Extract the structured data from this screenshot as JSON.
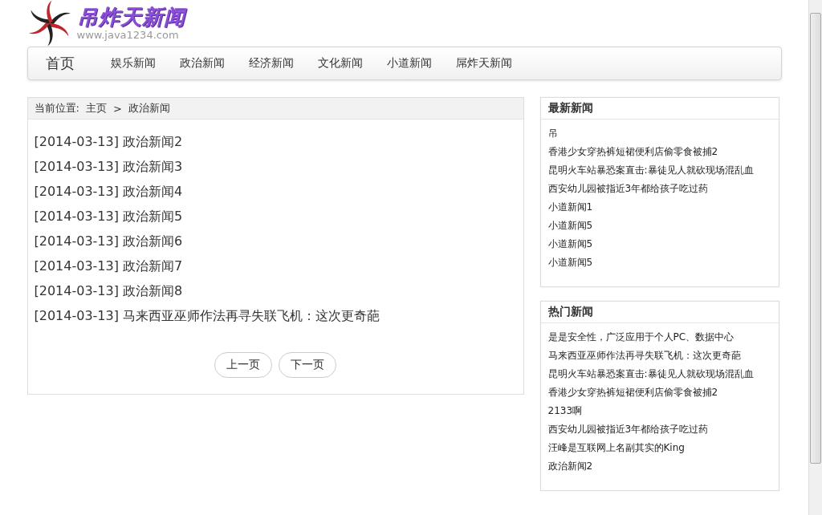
{
  "header": {
    "logo_text": "吊炸天新闻",
    "site_url": "www.java1234.com"
  },
  "nav": {
    "items": [
      {
        "label": "首页",
        "kind": "home"
      },
      {
        "label": "娱乐新闻",
        "kind": "link"
      },
      {
        "label": "政治新闻",
        "kind": "link"
      },
      {
        "label": "经济新闻",
        "kind": "link"
      },
      {
        "label": "文化新闻",
        "kind": "link"
      },
      {
        "label": "小道新闻",
        "kind": "link"
      },
      {
        "label": "屌炸天新闻",
        "kind": "link"
      }
    ]
  },
  "breadcrumb": {
    "label": "当前位置:",
    "items": [
      "主页",
      "政治新闻"
    ],
    "separator": ">"
  },
  "news_list": [
    {
      "date": "[2014-03-13]",
      "title": "政治新闻2"
    },
    {
      "date": "[2014-03-13]",
      "title": "政治新闻3"
    },
    {
      "date": "[2014-03-13]",
      "title": "政治新闻4"
    },
    {
      "date": "[2014-03-13]",
      "title": "政治新闻5"
    },
    {
      "date": "[2014-03-13]",
      "title": "政治新闻6"
    },
    {
      "date": "[2014-03-13]",
      "title": "政治新闻7"
    },
    {
      "date": "[2014-03-13]",
      "title": "政治新闻8"
    },
    {
      "date": "[2014-03-13]",
      "title": "马来西亚巫师作法再寻失联飞机：这次更奇葩"
    }
  ],
  "pagination": [
    "上一页",
    "下一页"
  ],
  "sidebar": [
    {
      "title": "最新新闻",
      "items": [
        "吊",
        "香港少女穿热裤短裙便利店偷零食被捕2",
        "昆明火车站暴恐案直击:暴徒见人就砍现场混乱血",
        "西安幼儿园被指近3年都给孩子吃过药",
        "小道新闻1",
        "小道新闻5",
        "小道新闻5",
        "小道新闻5"
      ]
    },
    {
      "title": "热门新闻",
      "items": [
        "是是安全性，广泛应用于个人PC、数据中心",
        "马来西亚巫师作法再寻失联飞机：这次更奇葩",
        "昆明火车站暴恐案直击:暴徒见人就砍现场混乱血",
        "香港少女穿热裤短裙便利店偷零食被捕2",
        "2133啊",
        "西安幼儿园被指近3年都给孩子吃过药",
        "汪峰是互联网上名副其实的King",
        "政治新闻2"
      ]
    }
  ]
}
